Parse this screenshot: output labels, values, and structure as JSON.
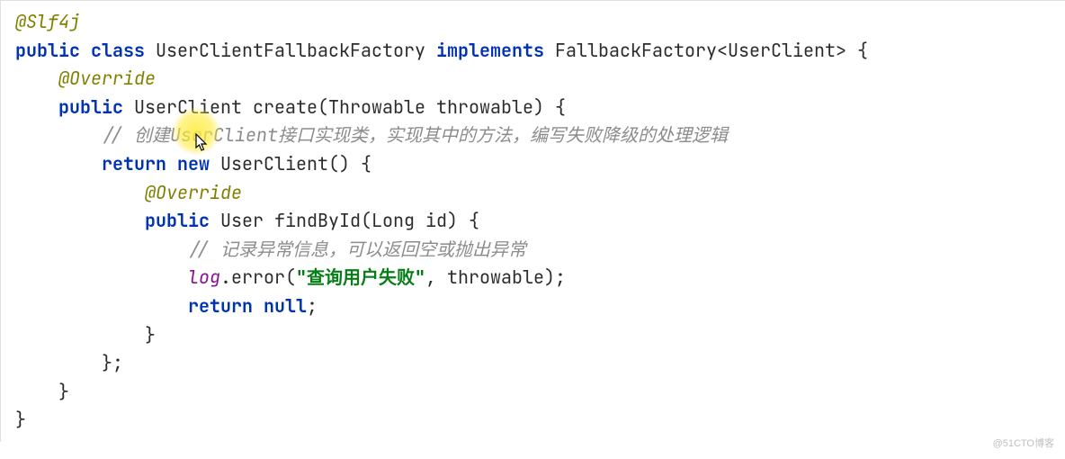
{
  "code": {
    "annotation_slf4j": "@Slf4j",
    "kw_public1": "public",
    "kw_class": "class",
    "class_name": "UserClientFallbackFactory",
    "kw_implements": "implements",
    "impl_type": "FallbackFactory<UserClient>",
    "brace_open1": " {",
    "indent1": "    ",
    "annotation_override1": "@Override",
    "kw_public2": "public",
    "ret_type1": "UserClient",
    "method1": "create(Throwable throwable) {",
    "indent2": "        ",
    "comment1": "// 创建UserClient接口实现类，实现其中的方法，编写失败降级的处理逻辑",
    "kw_return1": "return",
    "kw_new": "new",
    "new_expr": "UserClient() {",
    "indent3": "            ",
    "annotation_override2": "@Override",
    "kw_public3": "public",
    "ret_type2": "User",
    "method2": "findById(Long id) {",
    "indent4": "                ",
    "comment2": "// 记录异常信息，可以返回空或抛出异常",
    "log_ident": "log",
    "log_call_open": ".error(",
    "log_str": "\"查询用户失败\"",
    "log_call_close": ", throwable);",
    "kw_return2": "return",
    "kw_null": "null",
    "semi": ";",
    "brace_close_i3": "            }",
    "brace_close_i2b": "        };",
    "brace_close_i1": "    }",
    "brace_close_0": "}"
  },
  "watermark": "@51CTO博客"
}
